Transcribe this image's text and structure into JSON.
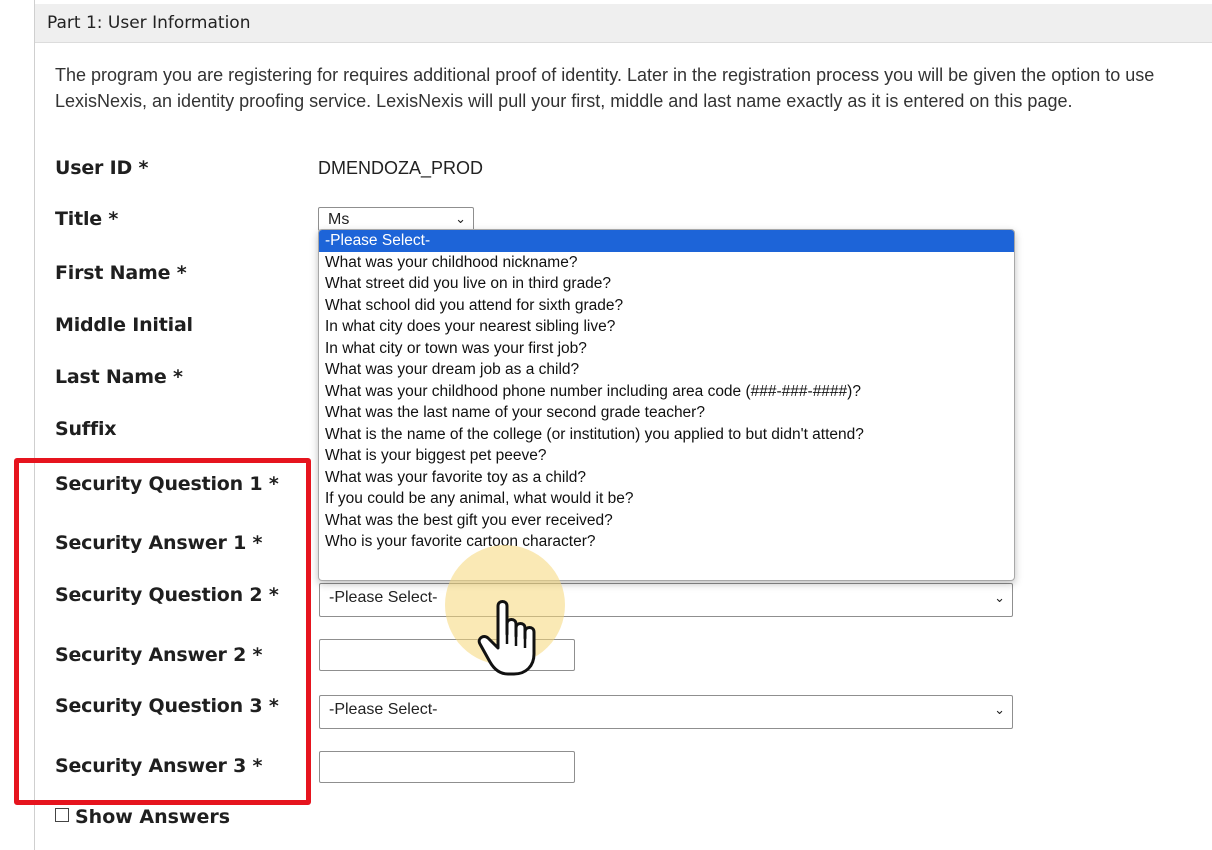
{
  "section": {
    "title": "Part 1: User Information"
  },
  "intro": "The program you are registering for requires additional proof of identity. Later in the registration process you will be given the option to use LexisNexis, an identity proofing service. LexisNexis will pull your first, middle and last name exactly as it is entered on this page.",
  "labels": {
    "user_id": "User ID *",
    "title": "Title *",
    "first_name": "First Name *",
    "middle_initial": "Middle Initial",
    "last_name": "Last Name *",
    "suffix": "Suffix",
    "sq1": "Security Question 1 *",
    "sa1": "Security Answer 1 *",
    "sq2": "Security Question 2 *",
    "sa2": "Security Answer 2 *",
    "sq3": "Security Question 3 *",
    "sa3": "Security Answer 3 *"
  },
  "values": {
    "user_id": "DMENDOZA_PROD",
    "title": "Ms",
    "sq2": "-Please Select-",
    "sq3": "-Please Select-",
    "sa2": "",
    "sa3": ""
  },
  "dropdown_options": [
    "-Please Select-",
    "What was your childhood nickname?",
    "What street did you live on in third grade?",
    "What school did you attend for sixth grade?",
    "In what city does your nearest sibling live?",
    "In what city or town was your first job?",
    "What was your dream job as a child?",
    "What was your childhood phone number including area code (###-###-####)?",
    "What was the last name of your second grade teacher?",
    "What is the name of the college (or institution) you applied to but didn't attend?",
    "What is your biggest pet peeve?",
    "What was your favorite toy as a child?",
    "If you could be any animal, what would it be?",
    "What was the best gift you ever received?",
    "Who is your favorite cartoon character?"
  ],
  "dropdown_selected_index": 0,
  "show_answers": {
    "label": "Show Answers",
    "checked": false
  },
  "icons": {
    "caret": "chevron-down-icon",
    "cursor": "hand-pointer-icon",
    "checkbox": "checkbox-icon"
  },
  "colors": {
    "highlight_box": "#e6141e",
    "selected_option": "#1d64d8",
    "cursor_glow": "#f5d778"
  }
}
